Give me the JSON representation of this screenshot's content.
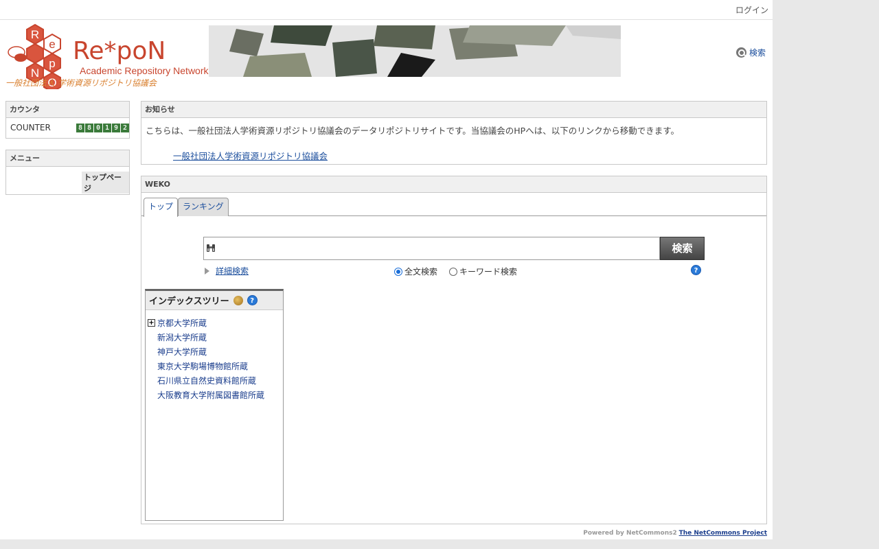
{
  "header": {
    "login": "ログイン",
    "search": "検索",
    "logo_text": "Re*poN",
    "logo_sub": "Academic Repository Network",
    "logo_org": "一般社団法人 学術資源リポジトリ協議会",
    "logo_hex_letters": [
      "R",
      "e",
      "p",
      "N",
      "O"
    ]
  },
  "counter": {
    "title": "カウンタ",
    "label": "COUNTER",
    "digits": [
      "8",
      "8",
      "0",
      "1",
      "9",
      "2"
    ]
  },
  "menu": {
    "title": "メニュー",
    "items": [
      "トップページ"
    ]
  },
  "notice": {
    "title": "お知らせ",
    "text": "こちらは、一般社団法人学術資源リポジトリ協議会のデータリポジトリサイトです。当協議会のHPへは、以下のリンクから移動できます。",
    "link": "一般社団法人学術資源リポジトリ協議会"
  },
  "weko": {
    "title": "WEKO",
    "tabs": [
      "トップ",
      "ランキング"
    ],
    "search_value": "",
    "search_button": "検索",
    "advanced": "詳細検索",
    "radio_full": "全文検索",
    "radio_keyword": "キーワード検索",
    "help": "?",
    "tree_title": "インデックスツリー",
    "tree_items": [
      "京都大学所蔵",
      "新潟大学所蔵",
      "神戸大学所蔵",
      "東京大学駒場博物館所蔵",
      "石川県立自然史資料館所蔵",
      "大阪教育大学附属図書館所蔵"
    ]
  },
  "footer": {
    "powered": "Powered by NetCommons2",
    "project": "The NetCommons Project"
  },
  "colors": {
    "link": "#1a4d9c",
    "logo_red": "#c8452e",
    "counter_green": "#3a7a3a"
  }
}
